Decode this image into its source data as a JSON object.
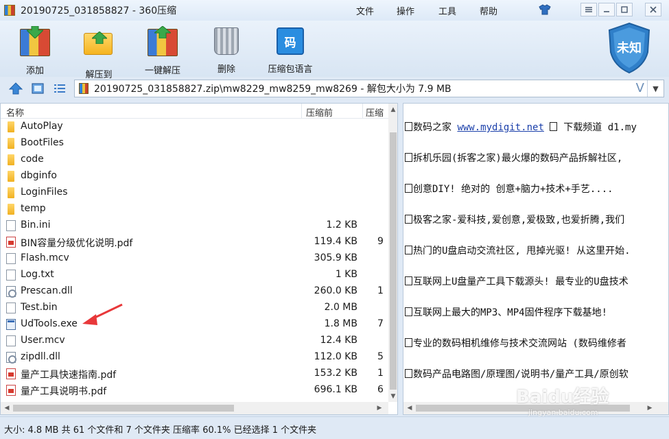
{
  "window": {
    "title": "20190725_031858827 - 360压缩",
    "menu": [
      "文件",
      "操作",
      "工具",
      "帮助"
    ]
  },
  "toolbar": {
    "buttons": [
      {
        "label": "添加",
        "icon": "add-archive-icon"
      },
      {
        "label": "解压到",
        "icon": "extract-to-icon"
      },
      {
        "label": "一键解压",
        "icon": "one-click-extract-icon"
      },
      {
        "label": "删除",
        "icon": "delete-icon"
      },
      {
        "label": "压缩包语言",
        "icon": "archive-language-icon"
      }
    ],
    "language_glyph": "码",
    "badge_text": "未知"
  },
  "address": {
    "path": "20190725_031858827.zip\\mw8229_mw8259_mw8269 - 解包大小为 7.9 MB"
  },
  "file_list": {
    "columns": [
      "名称",
      "压缩前",
      "压缩"
    ],
    "rows": [
      {
        "name": "AutoPlay",
        "type": "folder",
        "size": "",
        "csize": ""
      },
      {
        "name": "BootFiles",
        "type": "folder",
        "size": "",
        "csize": ""
      },
      {
        "name": "code",
        "type": "folder",
        "size": "",
        "csize": ""
      },
      {
        "name": "dbginfo",
        "type": "folder",
        "size": "",
        "csize": ""
      },
      {
        "name": "LoginFiles",
        "type": "folder",
        "size": "",
        "csize": ""
      },
      {
        "name": "temp",
        "type": "folder",
        "size": "",
        "csize": ""
      },
      {
        "name": "Bin.ini",
        "type": "ini",
        "size": "1.2 KB",
        "csize": ""
      },
      {
        "name": "BIN容量分级优化说明.pdf",
        "type": "pdf",
        "size": "119.4 KB",
        "csize": "9"
      },
      {
        "name": "Flash.mcv",
        "type": "file",
        "size": "305.9 KB",
        "csize": ""
      },
      {
        "name": "Log.txt",
        "type": "ini",
        "size": "1 KB",
        "csize": ""
      },
      {
        "name": "Prescan.dll",
        "type": "dll",
        "size": "260.0 KB",
        "csize": "1"
      },
      {
        "name": "Test.bin",
        "type": "file",
        "size": "2.0 MB",
        "csize": ""
      },
      {
        "name": "UdTools.exe",
        "type": "exe",
        "size": "1.8 MB",
        "csize": "7"
      },
      {
        "name": "User.mcv",
        "type": "file",
        "size": "12.4 KB",
        "csize": ""
      },
      {
        "name": "zipdll.dll",
        "type": "dll",
        "size": "112.0 KB",
        "csize": "5"
      },
      {
        "name": "量产工具快速指南.pdf",
        "type": "pdf",
        "size": "153.2 KB",
        "csize": "1"
      },
      {
        "name": "量产工具说明书.pdf",
        "type": "pdf",
        "size": "696.1 KB",
        "csize": "6"
      }
    ]
  },
  "preview": {
    "lines": [
      {
        "text": "数码之家 ",
        "link": "www.mydigit.net",
        "after": "  下载频道 d1.my"
      },
      {
        "text": "拆机乐园(拆客之家)最火爆的数码产品拆解社区,"
      },
      {
        "text": "创意DIY! 绝对的 创意+脑力+技术+手艺...."
      },
      {
        "text": "极客之家-爱科技,爱创意,爱极致,也爱折腾,我们"
      },
      {
        "text": "热门的U盘启动交流社区, 甩掉光驱! 从这里开始."
      },
      {
        "text": "互联网上U盘量产工具下载源头! 最专业的U盘技术"
      },
      {
        "text": "互联网上最大的MP3、MP4固件程序下载基地!"
      },
      {
        "text": "专业的数码相机维修与技术交流网站 (数码维修者"
      },
      {
        "text": "数码产品电路图/原理图/说明书/量产工具/原创软"
      }
    ]
  },
  "watermark": {
    "logo": "Baidu经验",
    "sub": "jingyan.baidu.com"
  },
  "status": {
    "text": "大小: 4.8 MB 共 61 个文件和 7 个文件夹 压缩率 60.1% 已经选择 1 个文件夹"
  },
  "colors": {
    "accent": "#2a8de0",
    "link": "#1a3faa",
    "annotation": "#e8383a"
  }
}
